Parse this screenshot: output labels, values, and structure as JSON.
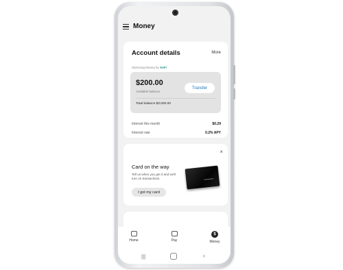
{
  "header": {
    "title": "Money"
  },
  "account": {
    "title": "Account details",
    "more": "More",
    "provider_prefix": "Samsung Money by",
    "provider_brand": "SoFi",
    "balance": "$200.00",
    "balance_label": "Available balance",
    "transfer_label": "Transfer",
    "total_balance": "Total balance $3,000.00",
    "interest_month_label": "Interest this month",
    "interest_month_value": "$0.29",
    "interest_rate_label": "Interest rate",
    "interest_rate_value": "0.2% APY"
  },
  "promo": {
    "close": "×",
    "title": "Card on the way",
    "description": "Tell us when you get it and we'll turn on transactions.",
    "button": "I got my card"
  },
  "bottom_nav": [
    {
      "label": "Home",
      "icon": "home-icon"
    },
    {
      "label": "Pay",
      "icon": "pay-icon"
    },
    {
      "label": "Money",
      "icon": "money-icon",
      "glyph": "$"
    }
  ],
  "system_nav": {
    "recents": "|||",
    "back": "‹"
  }
}
